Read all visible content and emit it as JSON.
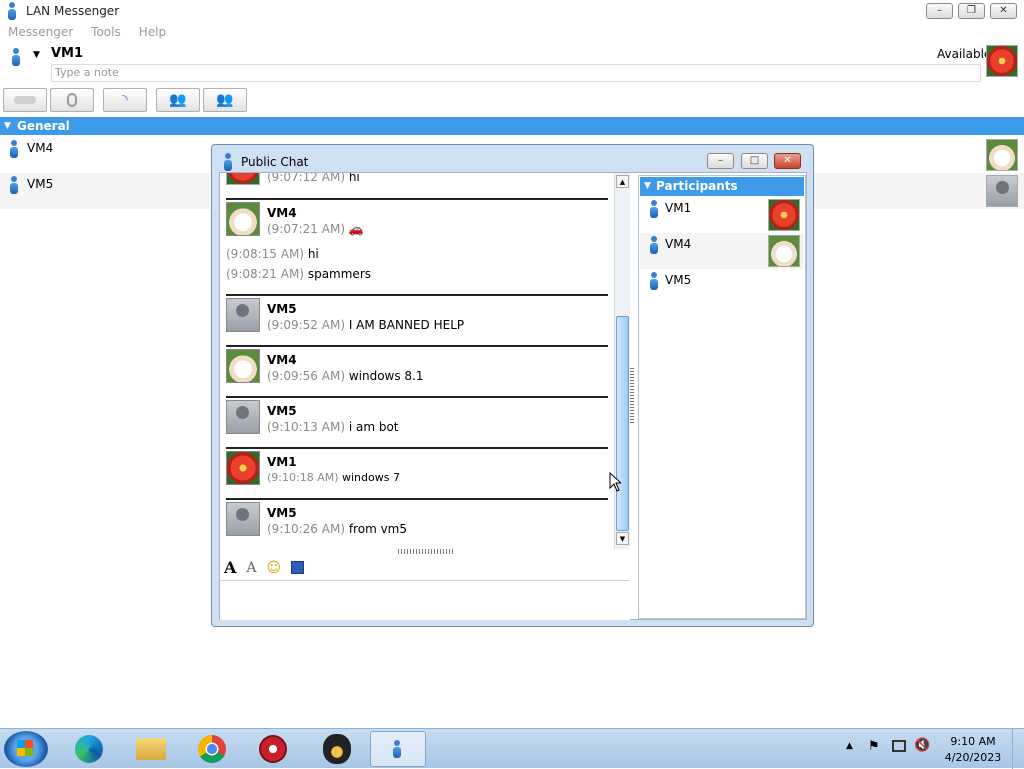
{
  "app": {
    "title": "LAN Messenger",
    "menus": [
      "Messenger",
      "Tools",
      "Help"
    ],
    "user": {
      "name": "VM1",
      "status": "Available",
      "note_placeholder": "Type a note"
    }
  },
  "contacts": {
    "group": "General",
    "items": [
      {
        "name": "VM4",
        "avatar": "cat"
      },
      {
        "name": "VM5",
        "avatar": "blank"
      }
    ]
  },
  "chat": {
    "title": "Public Chat",
    "top_partial": {
      "time": "(9:07:12 AM)",
      "text": "hi"
    },
    "messages": [
      {
        "sender": "VM4",
        "avatar": "cat",
        "lines": [
          {
            "time": "(9:07:21 AM)",
            "text": "🚗"
          }
        ],
        "extra": [
          {
            "time": "(9:08:15 AM)",
            "text": "hi"
          },
          {
            "time": "(9:08:21 AM)",
            "text": "spammers"
          }
        ]
      },
      {
        "sender": "VM5",
        "avatar": "blank",
        "lines": [
          {
            "time": "(9:09:52 AM)",
            "text": "I AM BANNED HELP"
          }
        ]
      },
      {
        "sender": "VM4",
        "avatar": "cat",
        "lines": [
          {
            "time": "(9:09:56 AM)",
            "text": "windows 8.1"
          }
        ]
      },
      {
        "sender": "VM5",
        "avatar": "blank",
        "lines": [
          {
            "time": "(9:10:13 AM)",
            "text": "i am bot"
          }
        ]
      },
      {
        "sender": "VM1",
        "avatar": "flower",
        "lines": [
          {
            "time": "(9:10:18 AM)",
            "text": "windows 7"
          }
        ]
      },
      {
        "sender": "VM5",
        "avatar": "blank",
        "lines": [
          {
            "time": "(9:10:26 AM)",
            "text": "from vm5"
          }
        ]
      }
    ],
    "participants_header": "Participants",
    "participants": [
      {
        "name": "VM1",
        "avatar": "flower"
      },
      {
        "name": "VM4",
        "avatar": "cat"
      },
      {
        "name": "VM5",
        "avatar": "none"
      }
    ]
  },
  "taskbar": {
    "time": "9:10 AM",
    "date": "4/20/2023"
  },
  "colors": {
    "accent": "#3c9ae8",
    "taskbar": "#b8d2ec"
  }
}
